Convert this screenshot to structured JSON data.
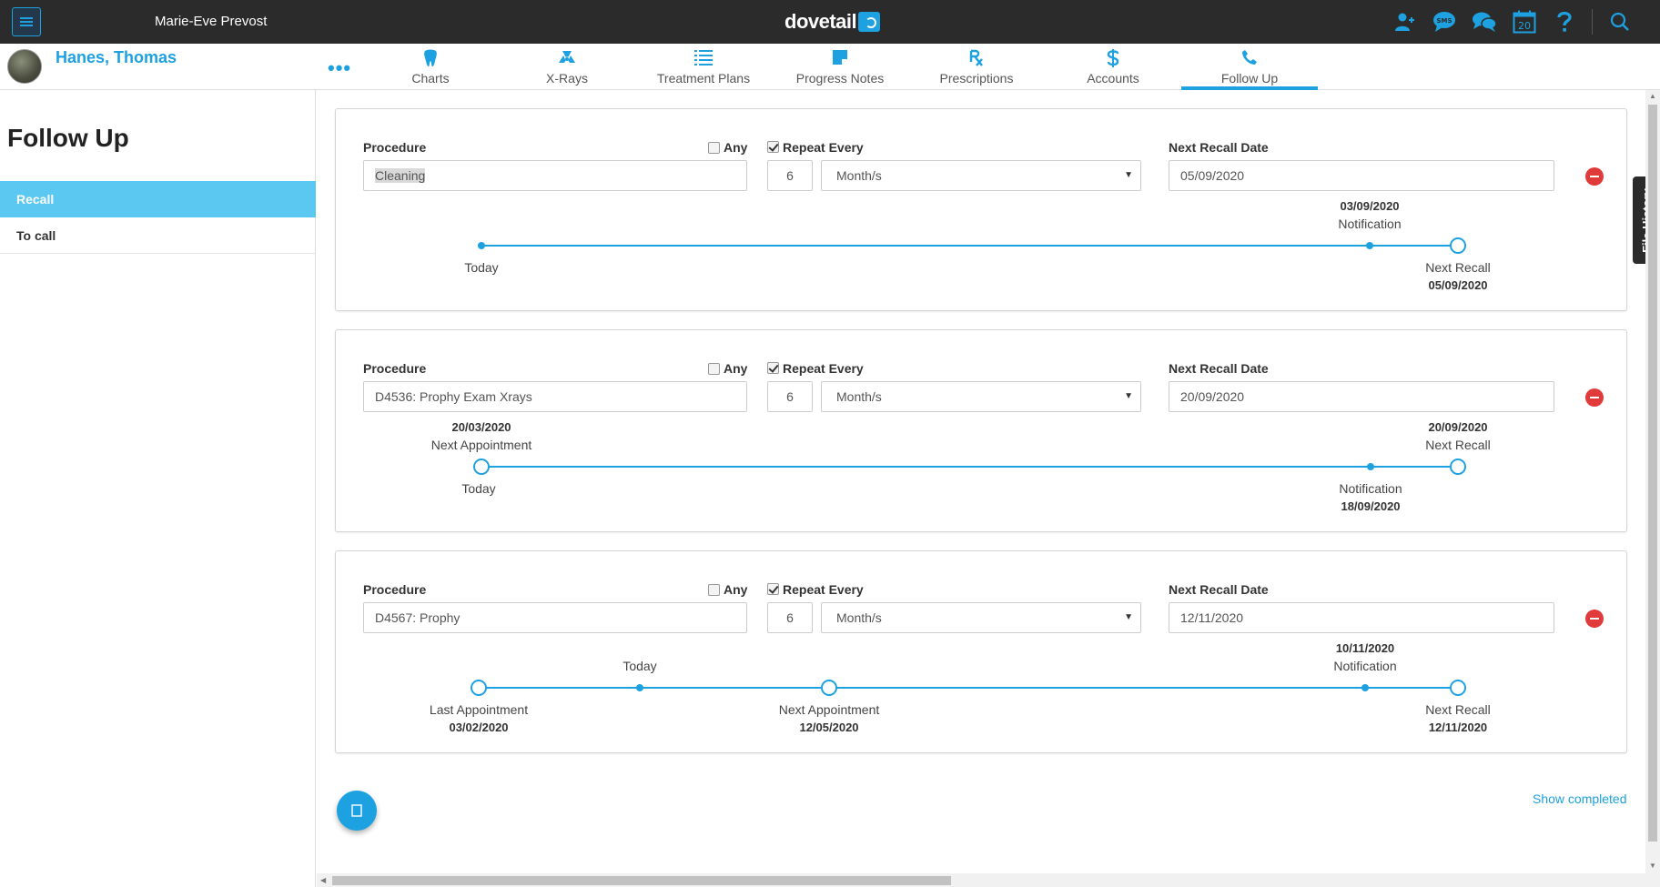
{
  "app": {
    "user_name": "Marie-Eve Prevost",
    "logo_text": "dovetail",
    "calendar_day": "20",
    "sms_label": "SMS",
    "brand_color": "#1da1e0",
    "topbar_color": "#2b2b2b"
  },
  "patient": {
    "name": "Hanes, Thomas",
    "more": "•••"
  },
  "tabs": [
    {
      "label": "Charts",
      "icon": "tooth-icon"
    },
    {
      "label": "X-Rays",
      "icon": "radiation-icon"
    },
    {
      "label": "Treatment Plans",
      "icon": "list-icon"
    },
    {
      "label": "Progress Notes",
      "icon": "note-icon"
    },
    {
      "label": "Prescriptions",
      "icon": "rx-icon"
    },
    {
      "label": "Accounts",
      "icon": "dollar-icon"
    },
    {
      "label": "Follow Up",
      "icon": "phone-icon",
      "active": true
    }
  ],
  "sidebar": {
    "title": "Follow Up",
    "items": [
      {
        "label": "Recall",
        "active": true
      },
      {
        "label": "To call",
        "active": false
      }
    ]
  },
  "labels": {
    "procedure": "Procedure",
    "any": "Any",
    "repeat_every": "Repeat Every",
    "next_recall_date": "Next Recall Date"
  },
  "recalls": [
    {
      "procedure": "Cleaning",
      "any": false,
      "repeat": true,
      "interval": "6",
      "unit": "Month/s",
      "next_recall_date": "05/09/2020",
      "timeline": {
        "today": "Today",
        "notification_label": "Notification",
        "notification_date": "03/09/2020",
        "next_recall_label": "Next Recall",
        "next_recall_date": "05/09/2020"
      }
    },
    {
      "procedure": "D4536: Prophy Exam Xrays",
      "any": false,
      "repeat": true,
      "interval": "6",
      "unit": "Month/s",
      "next_recall_date": "20/09/2020",
      "timeline": {
        "today": "Today",
        "next_appointment_label": "Next Appointment",
        "next_appointment_date": "20/03/2020",
        "notification_label": "Notification",
        "notification_date": "18/09/2020",
        "next_recall_label": "Next Recall",
        "next_recall_date": "20/09/2020"
      }
    },
    {
      "procedure": "D4567: Prophy",
      "any": false,
      "repeat": true,
      "interval": "6",
      "unit": "Month/s",
      "next_recall_date": "12/11/2020",
      "timeline": {
        "today": "Today",
        "last_appointment_label": "Last Appointment",
        "last_appointment_date": "03/02/2020",
        "next_appointment_label": "Next Appointment",
        "next_appointment_date": "12/05/2020",
        "notification_label": "Notification",
        "notification_date": "10/11/2020",
        "next_recall_label": "Next Recall",
        "next_recall_date": "12/11/2020"
      }
    }
  ],
  "file_history": "File History",
  "show_completed": "Show completed"
}
